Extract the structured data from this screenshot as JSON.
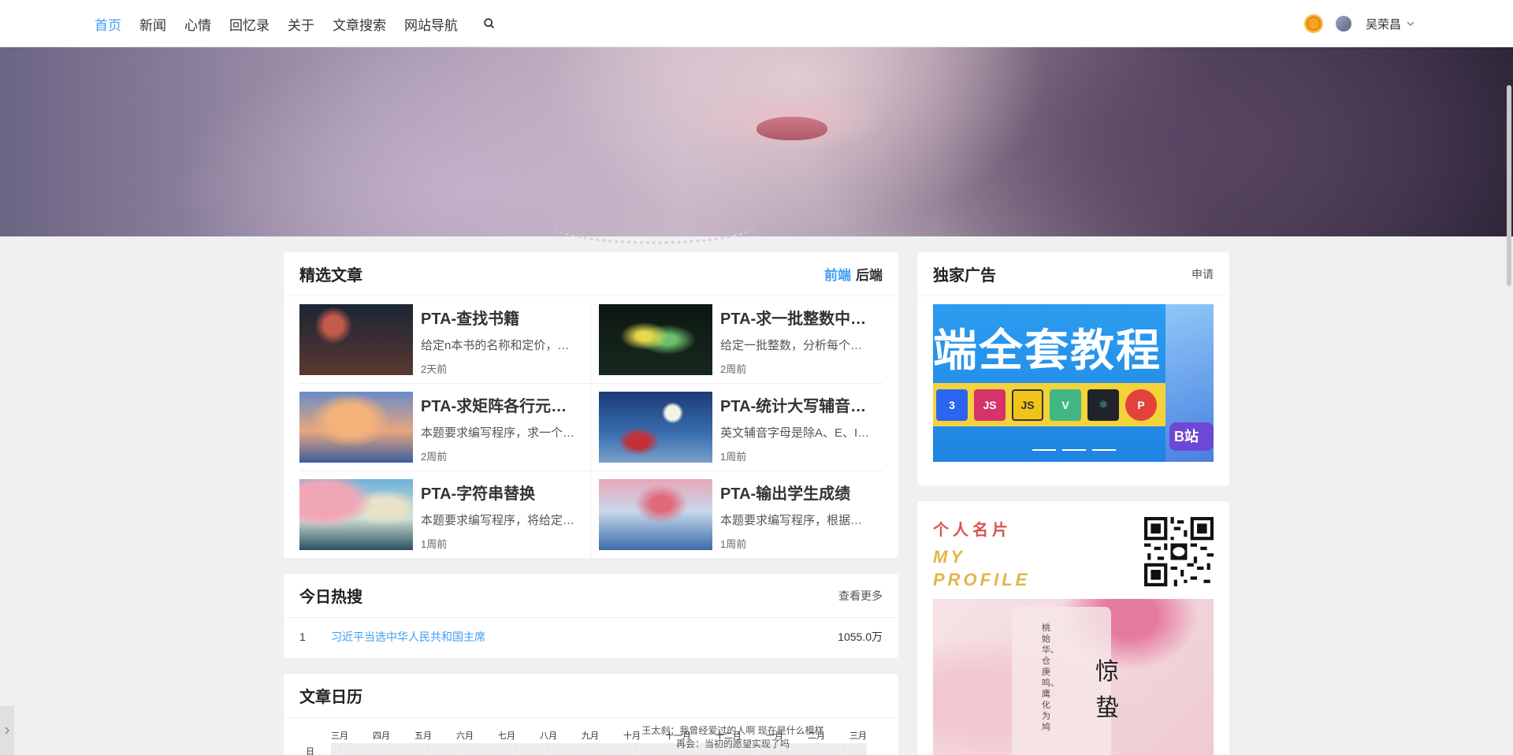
{
  "nav": {
    "links": [
      "首页",
      "新闻",
      "心情",
      "回忆录",
      "关于",
      "文章搜索",
      "网站导航"
    ],
    "active_index": 0,
    "user_name": "吴荣昌"
  },
  "featured": {
    "title": "精选文章",
    "tabs": [
      "前端",
      "后端"
    ],
    "articles": [
      {
        "title": "PTA-查找书籍",
        "desc": "给定n本书的名称和定价，…",
        "time": "2天前"
      },
      {
        "title": "PTA-求一批整数中…",
        "desc": "给定一批整数，分析每个…",
        "time": "2周前"
      },
      {
        "title": "PTA-求矩阵各行元…",
        "desc": "本题要求编写程序，求一个…",
        "time": "2周前"
      },
      {
        "title": "PTA-统计大写辅音…",
        "desc": "英文辅音字母是除A、E、I…",
        "time": "1周前"
      },
      {
        "title": "PTA-字符串替换",
        "desc": "本题要求编写程序，将给定…",
        "time": "1周前"
      },
      {
        "title": "PTA-输出学生成绩",
        "desc": "本题要求编写程序，根据…",
        "time": "1周前"
      }
    ]
  },
  "hot": {
    "title": "今日热搜",
    "more": "查看更多",
    "items": [
      {
        "rank": "1",
        "text": "习近平当选中华人民共和国主席",
        "count": "1055.0万"
      }
    ]
  },
  "calendar": {
    "title": "文章日历",
    "months": [
      "三月",
      "四月",
      "五月",
      "六月",
      "七月",
      "八月",
      "九月",
      "十月",
      "十一月",
      "十二月",
      "一月",
      "二月",
      "三月"
    ],
    "day_label": "日",
    "quote_line1": "王太刹：我曾经爱过的人啊 现在是什么模样",
    "quote_line2": "再会：当初的愿望实现了吗"
  },
  "ads": {
    "title": "独家广告",
    "apply": "申请",
    "ad_text": "端全套教程",
    "logos": [
      "3",
      "JS",
      "JS",
      "V",
      "⚛",
      "P"
    ],
    "side_text": "B站"
  },
  "profile": {
    "title": "个人名片",
    "subtitle_line1": "MY",
    "subtitle_line2": "PROFILE",
    "big_chars": "惊蛰",
    "vertical_text": "桃始华、仓庚鸣、鹰化为鸠"
  },
  "colors": {
    "accent": "#3e9ef5",
    "profile_red": "#d9534f",
    "profile_gold": "#e0b64a"
  }
}
